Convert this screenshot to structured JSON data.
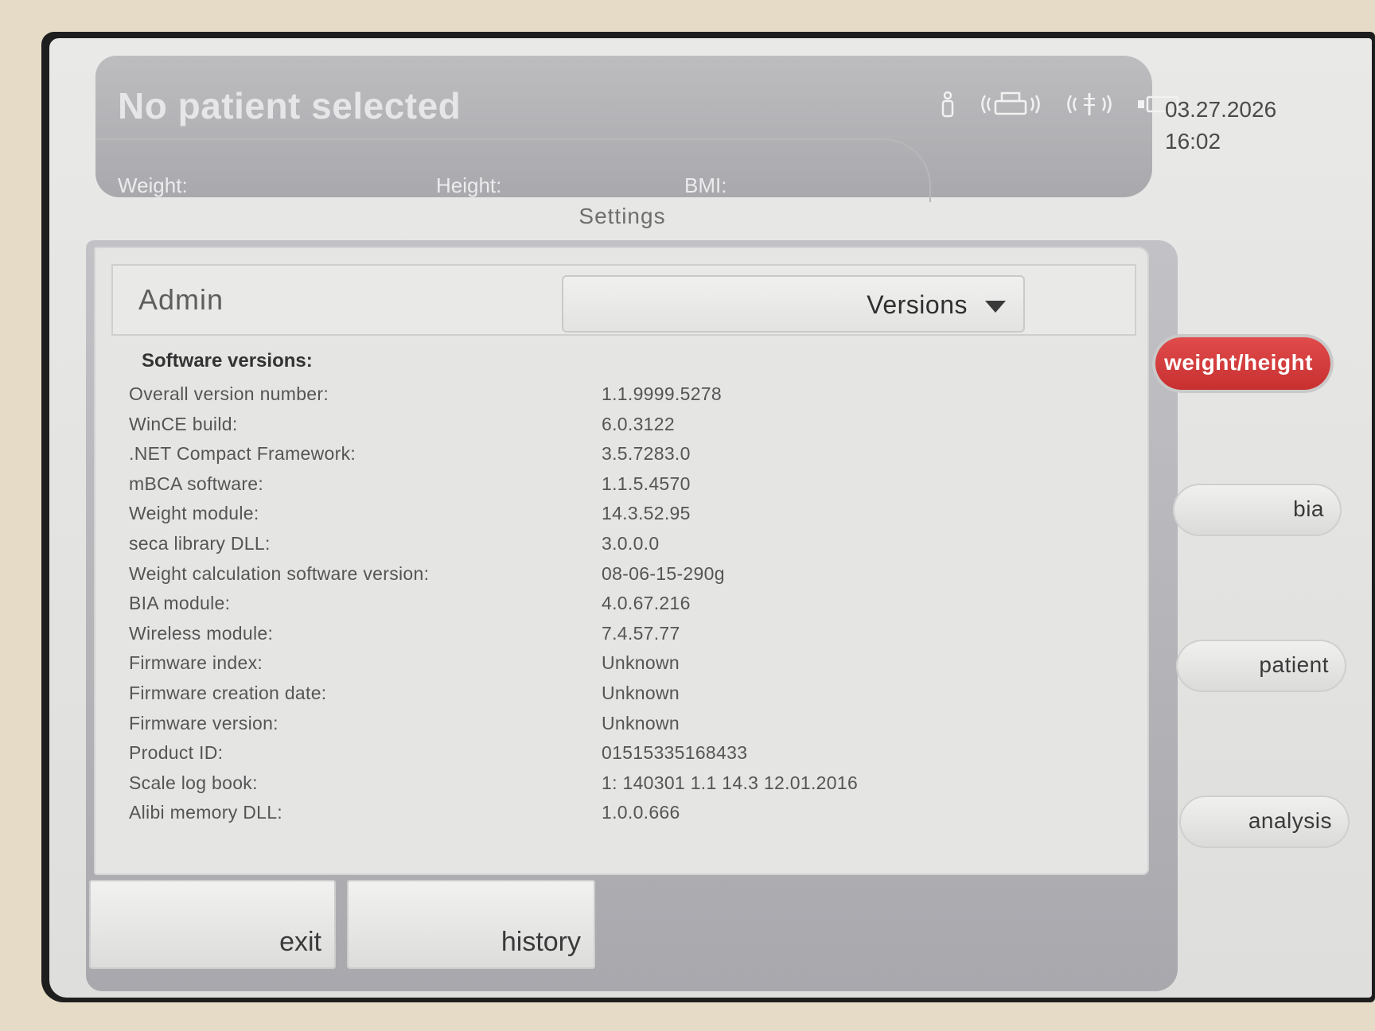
{
  "header": {
    "patient_status": "No patient selected",
    "weight_label": "Weight:",
    "height_label": "Height:",
    "bmi_label": "BMI:",
    "status_icons": [
      "person-icon",
      "printer-wireless-icon",
      "wireless-signal-icon",
      "battery-icon"
    ]
  },
  "datetime": {
    "date": "03.27.2026",
    "time": "16:02"
  },
  "page_title": "Settings",
  "admin": {
    "label": "Admin",
    "dropdown_value": "Versions"
  },
  "software": {
    "heading": "Software versions:",
    "rows": [
      {
        "label": "Overall version number:",
        "value": "1.1.9999.5278"
      },
      {
        "label": "WinCE build:",
        "value": "6.0.3122"
      },
      {
        "label": ".NET Compact Framework:",
        "value": "3.5.7283.0"
      },
      {
        "label": "mBCA software:",
        "value": "1.1.5.4570"
      },
      {
        "label": "Weight module:",
        "value": "14.3.52.95"
      },
      {
        "label": "seca library DLL:",
        "value": "3.0.0.0"
      },
      {
        "label": "Weight calculation software version:",
        "value": "08-06-15-290g"
      },
      {
        "label": "BIA module:",
        "value": "4.0.67.216"
      },
      {
        "label": "Wireless module:",
        "value": "7.4.57.77"
      },
      {
        "label": "Firmware index:",
        "value": "Unknown"
      },
      {
        "label": "Firmware creation date:",
        "value": "Unknown"
      },
      {
        "label": "Firmware version:",
        "value": "Unknown"
      },
      {
        "label": "Product ID:",
        "value": "01515335168433"
      },
      {
        "label": "Scale log book:",
        "value": "1: 140301 1.1 14.3 12.01.2016"
      },
      {
        "label": "Alibi memory DLL:",
        "value": "1.0.0.666"
      }
    ]
  },
  "bottom_buttons": {
    "exit": "exit",
    "history": "history"
  },
  "side_nav": {
    "weight_height": "weight/height",
    "bia": "bia",
    "patient": "patient",
    "analysis": "analysis",
    "active_color": "#d43c3c"
  }
}
